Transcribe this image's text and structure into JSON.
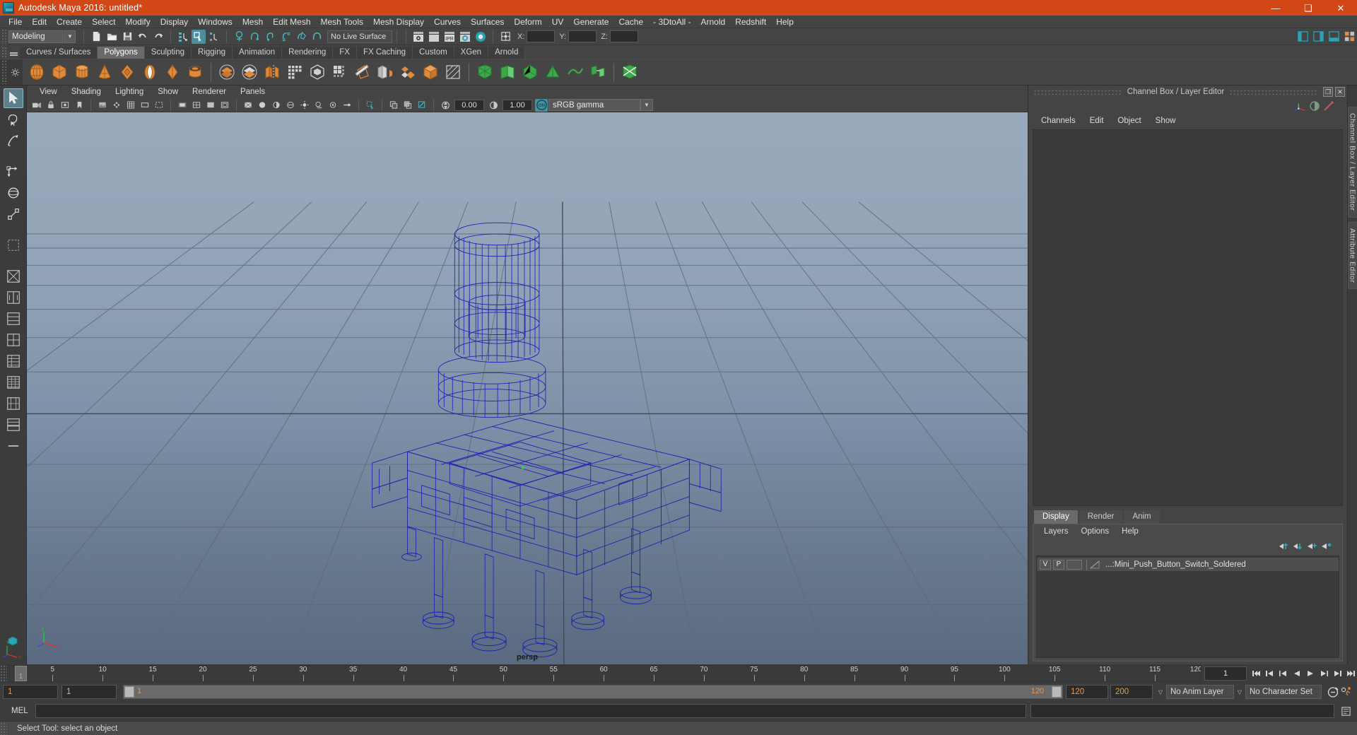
{
  "window": {
    "title": "Autodesk Maya 2016: untitled*",
    "app_icon": "maya-logo-icon",
    "minimize": "—",
    "maximize": "❑",
    "close": "✕"
  },
  "menubar": {
    "items": [
      "File",
      "Edit",
      "Create",
      "Select",
      "Modify",
      "Display",
      "Windows",
      "Mesh",
      "Edit Mesh",
      "Mesh Tools",
      "Mesh Display",
      "Curves",
      "Surfaces",
      "Deform",
      "UV",
      "Generate",
      "Cache",
      "- 3DtoAll -",
      "Arnold",
      "Redshift",
      "Help"
    ]
  },
  "statusline": {
    "mode": "Modeling",
    "mode_arrow": "▼",
    "live_surface": "No Live Surface",
    "coord_x_label": "X:",
    "coord_y_label": "Y:",
    "coord_z_label": "Z:",
    "coord_x_value": "",
    "coord_y_value": "",
    "coord_z_value": "",
    "ipr_label": "IPR",
    "icons": [
      "new-scene-icon",
      "open-scene-icon",
      "save-scene-icon",
      "undo-icon",
      "redo-icon",
      "select-by-hierarchy-icon",
      "select-by-object-icon",
      "select-by-component-icon",
      "snap-to-grid-icon",
      "snap-to-curve-icon",
      "snap-to-point-icon",
      "snap-to-projected-center-icon",
      "snap-to-view-plane-icon",
      "make-live-icon",
      "render-current-frame-icon",
      "render-sequence-icon",
      "ipr-render-icon",
      "render-settings-icon",
      "hypershade-icon",
      "editor-toggle-icon"
    ]
  },
  "shelf": {
    "tabs": [
      "Curves / Surfaces",
      "Polygons",
      "Sculpting",
      "Rigging",
      "Animation",
      "Rendering",
      "FX",
      "FX Caching",
      "Custom",
      "XGen",
      "Arnold"
    ],
    "selected_tab": "Polygons",
    "icons": [
      "poly-sphere-icon",
      "poly-cube-icon",
      "poly-cylinder-icon",
      "poly-cone-icon",
      "poly-torus-icon",
      "poly-plane-icon",
      "poly-disc-icon",
      "poly-pipe-icon",
      "poly-boolean-union-icon",
      "poly-boolean-difference-icon",
      "poly-combine-icon",
      "poly-smooth-icon",
      "poly-extrude-icon",
      "poly-multi-cut-icon",
      "poly-bevel-icon",
      "poly-bridge-icon",
      "poly-append-icon",
      "poly-wedge-icon",
      "sculpt-tool-icon",
      "quad-draw-icon",
      "mirror-geometry-icon",
      "reduce-icon",
      "triangulate-icon",
      "retopologize-icon",
      "transfer-attributes-icon",
      "crease-tool-icon"
    ]
  },
  "toolbox": {
    "tools": [
      "select-tool",
      "lasso-select-tool",
      "paint-select-tool",
      "move-tool",
      "rotate-tool",
      "scale-tool",
      "last-tool",
      "show-manipulator-tool"
    ],
    "layouts": [
      "single-perspective-layout",
      "two-panes-side-layout",
      "two-panes-stacked-layout",
      "three-panes-layout",
      "four-panes-layout",
      "persp-outliner-layout",
      "hypershade-layout",
      "persp-graph-layout",
      "more-layouts"
    ],
    "axis_gizmo": "world-axis-gizmo"
  },
  "viewport": {
    "menus": [
      "View",
      "Shading",
      "Lighting",
      "Show",
      "Renderer",
      "Panels"
    ],
    "camera_label": "persp",
    "exposure_value": "0.00",
    "gamma_value": "1.00",
    "color_management": "sRGB gamma",
    "cm_toggle_label": "ON",
    "cm_arrow": "▼",
    "toolbar_icons": [
      "select-camera-icon",
      "lock-camera-icon",
      "camera-attributes-icon",
      "bookmark-icon",
      "image-plane-icon",
      "two-d-pan-zoom-icon",
      "grid-toggle-icon",
      "film-gate-icon",
      "resolution-gate-icon",
      "gate-mask-icon",
      "field-chart-icon",
      "safe-action-icon",
      "safe-title-icon",
      "xray-icon",
      "xray-joints-icon",
      "wireframe-on-shaded-icon",
      "smooth-shade-icon",
      "flat-shade-icon",
      "shaded-wireframe-icon",
      "textured-icon",
      "use-all-lights-icon",
      "shadows-icon",
      "screen-space-ao-icon",
      "motion-blur-icon",
      "multisample-icon",
      "depth-of-field-icon",
      "isolate-select-icon",
      "snapshot-icon",
      "xray-mode-icon",
      "exposure-icon",
      "contrast-icon",
      "color-management-icon"
    ],
    "model": {
      "name": "Mini_Push_Button_Switch_Soldered",
      "wireframe_color": "#1d1bb5",
      "display": "wireframe"
    },
    "background_top": "#96a6b8",
    "background_bottom": "#5d6d82"
  },
  "channel_box": {
    "panel_title": "Channel Box / Layer Editor",
    "undock_label": "❐",
    "close_label": "✕",
    "menus": [
      "Channels",
      "Edit",
      "Object",
      "Show"
    ],
    "header_icons": [
      "show-manipulators-icon",
      "channel-box-icon",
      "attribute-editor-icon"
    ],
    "content": ""
  },
  "layer_editor": {
    "tabs": [
      "Display",
      "Render",
      "Anim"
    ],
    "selected_tab": "Display",
    "menus": [
      "Layers",
      "Options",
      "Help"
    ],
    "buttons": [
      "move-layer-up-icon",
      "move-layer-down-icon",
      "new-layer-icon",
      "new-layer-from-selected-icon"
    ],
    "layers": [
      {
        "visibility": "V",
        "playback": "P",
        "shading": "",
        "name": "...:Mini_Push_Button_Switch_Soldered",
        "selected": true
      }
    ]
  },
  "edge_docks": {
    "tabs": [
      "Channel Box / Layer Editor",
      "Attribute Editor"
    ]
  },
  "timeline": {
    "current_frame": "1",
    "ticks": [
      5,
      10,
      15,
      20,
      25,
      30,
      35,
      40,
      45,
      50,
      55,
      60,
      65,
      70,
      75,
      80,
      85,
      90,
      95,
      100,
      105,
      110,
      115,
      120
    ],
    "frame_field": "1",
    "range_start": "1",
    "range_end": "1",
    "playback_start_label": "1",
    "playback_end_label": "120",
    "anim_end": "120",
    "scene_end": "200",
    "anim_layer": "No Anim Layer",
    "character_set": "No Character Set",
    "anim_layer_arrow": "▽",
    "character_set_arrow": "▽",
    "playback_buttons": [
      "go-to-start-icon",
      "step-back-frame-icon",
      "step-back-key-icon",
      "play-backwards-icon",
      "play-forwards-icon",
      "step-forward-key-icon",
      "step-forward-frame-icon",
      "go-to-end-icon"
    ],
    "extra_buttons": [
      "auto-key-icon",
      "animation-preferences-icon"
    ]
  },
  "command_line": {
    "language_label": "MEL",
    "input_value": "",
    "script-editor-button": "script-editor-icon"
  },
  "status_bar": {
    "message": "Select Tool: select an object"
  },
  "colors": {
    "title_bar": "#d34615",
    "chrome": "#444444",
    "panel": "#3c3c3c",
    "accent": "#4a8f9e",
    "shelf_icon": "#e08b3c",
    "wireframe": "#1d1bb5",
    "field_orange": "#e89a4a"
  }
}
